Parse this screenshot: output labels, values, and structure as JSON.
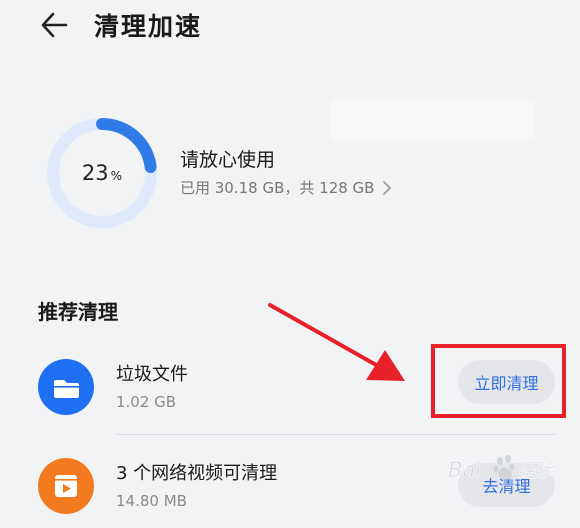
{
  "header": {
    "title": "清理加速",
    "back_icon": "arrow-left-icon"
  },
  "storage": {
    "percent_used": 23,
    "percent_number": "23",
    "percent_unit": "%",
    "status": "请放心使用",
    "detail": "已用 30.18 GB，共 128 GB",
    "chevron_icon": "chevron-right-icon",
    "ring_color": "#2f7be8",
    "ring_track_color": "#deeafb"
  },
  "recommend": {
    "section_title": "推荐清理",
    "items": [
      {
        "name": "垃圾文件",
        "size": "1.02 GB",
        "action": "立即清理",
        "icon": "folder-icon",
        "icon_color": "#1f6ff2"
      },
      {
        "name": "3 个网络视频可清理",
        "size": "14.80 MB",
        "action": "去清理",
        "icon": "video-icon",
        "icon_color": "#f47a1f"
      }
    ]
  },
  "annotation": {
    "highlight_color": "#e8202a",
    "arrow_color": "#e8202a"
  },
  "watermark": {
    "text": "Baidu 经验"
  }
}
